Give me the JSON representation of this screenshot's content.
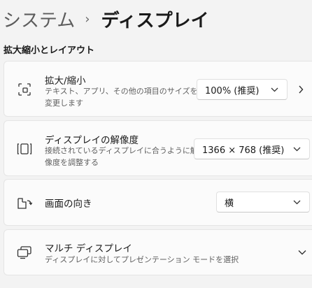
{
  "breadcrumb": {
    "parent": "システム",
    "separator": "›",
    "current": "ディスプレイ"
  },
  "section_header": "拡大縮小とレイアウト",
  "cards": {
    "scale": {
      "title": "拡大/縮小",
      "description_line1": "テキスト、アプリ、その他の項目のサイズを",
      "description_line2": "変更します",
      "dropdown_value": "100% (推奨)",
      "icon": "scale-icon"
    },
    "resolution": {
      "title": "ディスプレイの解像度",
      "description_line1": "接続されているディスプレイに合うように解",
      "description_line2": "像度を調整する",
      "dropdown_value": "1366 × 768 (推奨)",
      "icon": "resolution-icon"
    },
    "orientation": {
      "title": "画面の向き",
      "dropdown_value": "横",
      "icon": "orientation-icon"
    },
    "multi": {
      "title": "マルチ ディスプレイ",
      "description": "ディスプレイに対してプレゼンテーション モードを選択",
      "icon": "multi-display-icon"
    }
  }
}
